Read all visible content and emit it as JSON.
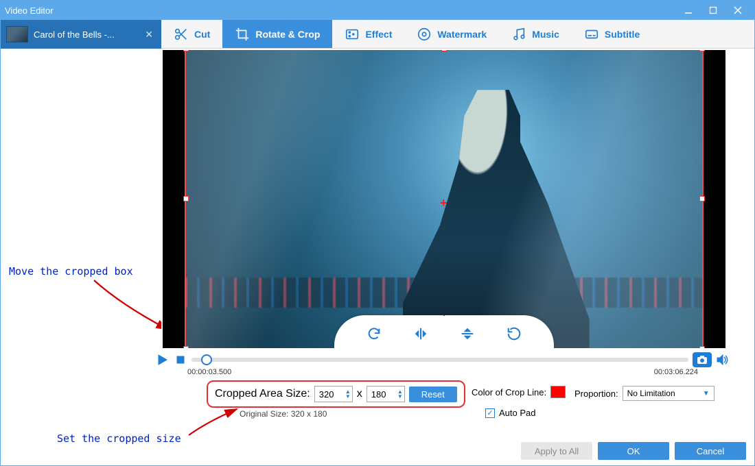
{
  "window": {
    "title": "Video Editor"
  },
  "file": {
    "name": "Carol of the Bells -..."
  },
  "tabs": {
    "cut": "Cut",
    "rotate": "Rotate & Crop",
    "effect": "Effect",
    "watermark": "Watermark",
    "music": "Music",
    "subtitle": "Subtitle"
  },
  "playback": {
    "current": "00:00:03.500",
    "duration": "00:03:06.224"
  },
  "crop": {
    "label": "Cropped Area Size:",
    "width": "320",
    "x": "x",
    "height": "180",
    "reset": "Reset",
    "original_label": "Original Size: 320 x 180"
  },
  "cropline": {
    "label": "Color of Crop Line:",
    "color": "#ff0000"
  },
  "proportion": {
    "label": "Proportion:",
    "value": "No Limitation"
  },
  "autopad": {
    "label": "Auto Pad",
    "checked": true
  },
  "buttons": {
    "apply_all": "Apply to All",
    "ok": "OK",
    "cancel": "Cancel"
  },
  "annotations": {
    "move_box": "Move the cropped box",
    "set_size": "Set the cropped size"
  }
}
